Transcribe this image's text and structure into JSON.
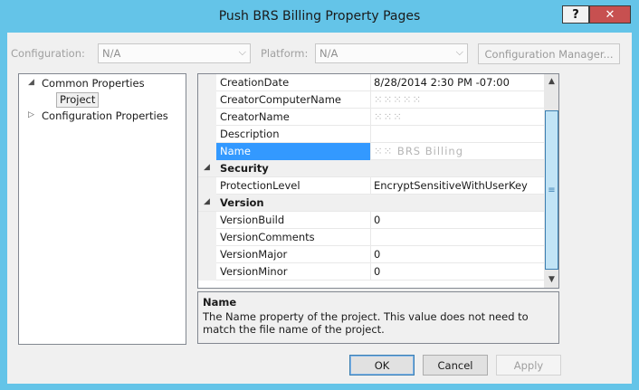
{
  "window": {
    "title": "Push BRS Billing Property Pages",
    "help_label": "?",
    "close_label": "✕"
  },
  "config_bar": {
    "configuration_label": "Configuration:",
    "configuration_value": "N/A",
    "platform_label": "Platform:",
    "platform_value": "N/A",
    "config_manager_label": "Configuration Manager..."
  },
  "tree": {
    "items": [
      {
        "label": "Common Properties",
        "expanded": true
      },
      {
        "label": "Project",
        "selected": true
      },
      {
        "label": "Configuration Properties",
        "expanded": false
      }
    ]
  },
  "property_grid": {
    "rows": [
      {
        "name": "CreationDate",
        "value": "8/28/2014 2:30 PM -07:00"
      },
      {
        "name": "CreatorComputerName",
        "value": "⁙⁙⁙⁙⁙"
      },
      {
        "name": "CreatorName",
        "value": "⁙⁙⁙"
      },
      {
        "name": "Description",
        "value": ""
      },
      {
        "name": "Name",
        "value": "⁙⁙ BRS Billing"
      },
      {
        "category": "Security"
      },
      {
        "name": "ProtectionLevel",
        "value": "EncryptSensitiveWithUserKey"
      },
      {
        "category": "Version"
      },
      {
        "name": "VersionBuild",
        "value": "0"
      },
      {
        "name": "VersionComments",
        "value": ""
      },
      {
        "name": "VersionMajor",
        "value": "0"
      },
      {
        "name": "VersionMinor",
        "value": "0"
      }
    ]
  },
  "description_panel": {
    "title": "Name",
    "text": "The Name property of the project. This value does not need to match the file name of the project."
  },
  "buttons": {
    "ok": "OK",
    "cancel": "Cancel",
    "apply": "Apply"
  },
  "colors": {
    "titlebar": "#64c4e8",
    "close_button": "#c75050",
    "selection": "#3399ff"
  }
}
